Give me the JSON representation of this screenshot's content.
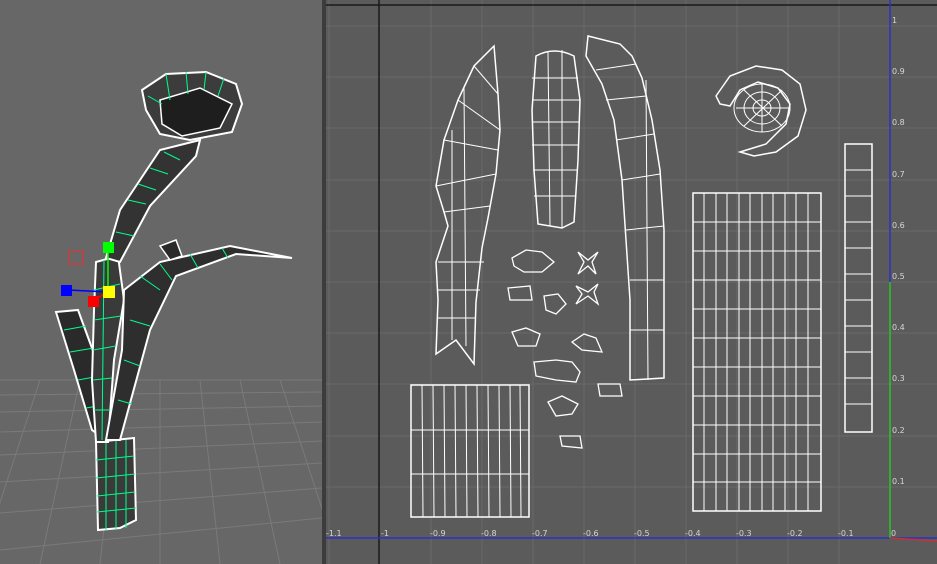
{
  "viewport": {
    "panel_name": "perspective-viewport",
    "manipulator_colors": {
      "x": "#ff0000",
      "y": "#00ff00",
      "z": "#0000ff",
      "center": "#ffff00"
    },
    "wire_color": "#00ff8c",
    "grid_color": "#7a7a7a"
  },
  "uv_editor": {
    "panel_name": "uv-texture-editor",
    "x_ticks": [
      "-1.1",
      "-1",
      "-0.9",
      "-0.8",
      "-0.7",
      "-0.6",
      "-0.5",
      "-0.4",
      "-0.3",
      "-0.2",
      "-0.1",
      "0"
    ],
    "y_ticks": [
      "1",
      "0.9",
      "0.8",
      "0.7",
      "0.6",
      "0.5",
      "0.4",
      "0.3",
      "0.2",
      "0.1"
    ],
    "axis_colors": {
      "u": "#3030c8",
      "v_upper": "#3030c8",
      "v_lower": "#28c828",
      "origin": "#c83232"
    },
    "shell_color": "#ffffff",
    "grid_color": "#6a6a6a"
  }
}
